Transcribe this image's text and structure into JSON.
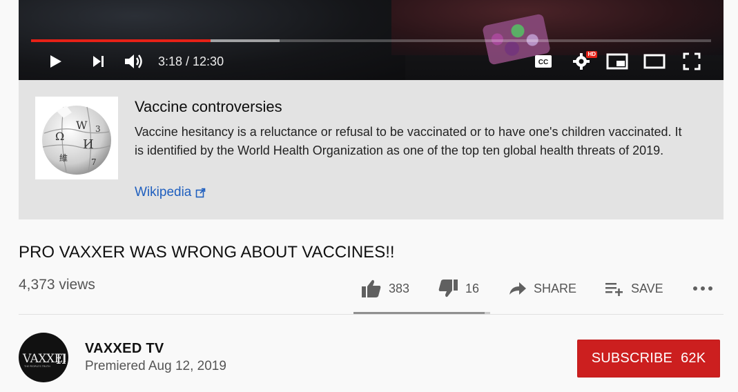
{
  "player": {
    "time_display": "3:18 / 12:30",
    "progress_fraction": 0.264,
    "buffered_fraction": 0.365,
    "hd_badge": "HD",
    "accent": "#e62117",
    "controls": [
      "play-icon",
      "next-icon",
      "volume-icon",
      "captions-icon",
      "settings-icon",
      "miniplayer-icon",
      "theater-mode-icon",
      "fullscreen-icon"
    ]
  },
  "info_panel": {
    "title": "Vaccine controversies",
    "text": "Vaccine hesitancy is a reluctance or refusal to be vaccinated or to have one's children vaccinated. It is identified by the World Health Organization as one of the top ten global health threats of 2019.",
    "link_label": "Wikipedia",
    "link_icon": "external-link-icon"
  },
  "video": {
    "title": "PRO VAXXER WAS WRONG ABOUT VACCINES!!",
    "views": "4,373 views",
    "likes": "383",
    "dislikes": "16",
    "share_label": "SHARE",
    "save_label": "SAVE",
    "like_fraction": 0.96
  },
  "channel": {
    "name": "VAXXED TV",
    "premiered": "Premiered Aug 12, 2019",
    "avatar_text": "VAXXED II",
    "subscribe_label": "SUBSCRIBE",
    "subscriber_count": "62K",
    "subscribe_color": "#cc1f1f"
  }
}
